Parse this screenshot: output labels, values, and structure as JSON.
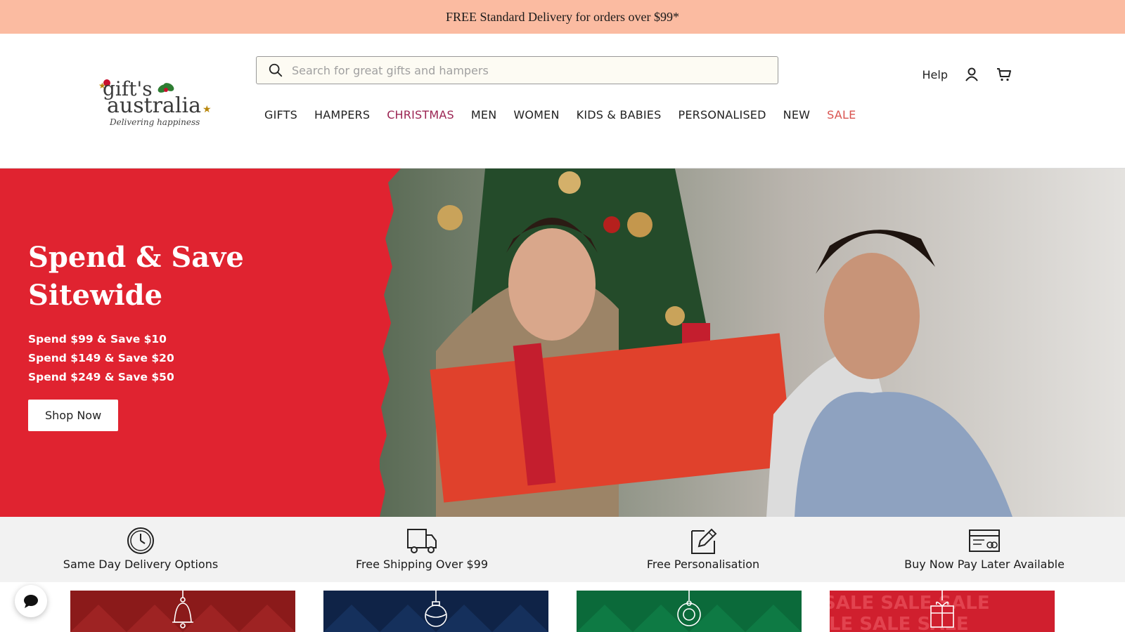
{
  "announcement": "FREE Standard Delivery for orders over $99*",
  "logo": {
    "brand_line1": "gift's",
    "brand_line2": "australia",
    "tagline": "Delivering happiness"
  },
  "search": {
    "placeholder": "Search for great gifts and hampers",
    "value": ""
  },
  "nav": [
    {
      "label": "GIFTS"
    },
    {
      "label": "HAMPERS"
    },
    {
      "label": "CHRISTMAS",
      "color": "#9b2452"
    },
    {
      "label": "MEN"
    },
    {
      "label": "WOMEN"
    },
    {
      "label": "KIDS & BABIES"
    },
    {
      "label": "PERSONALISED"
    },
    {
      "label": "NEW"
    },
    {
      "label": "SALE",
      "color": "#d9534f"
    }
  ],
  "utility": {
    "help": "Help",
    "account_icon": "user-icon",
    "cart_icon": "cart-icon"
  },
  "hero": {
    "title": "Spend & Save Sitewide",
    "offers": [
      "Spend $99 & Save $10",
      "Spend $149 & Save $20",
      "Spend $249 & Save $50"
    ],
    "cta": "Shop Now",
    "background_color": "#e02330"
  },
  "features": [
    {
      "label": "Same Day Delivery Options",
      "icon": "clock-icon"
    },
    {
      "label": "Free Shipping Over $99",
      "icon": "truck-icon"
    },
    {
      "label": "Free Personalisation",
      "icon": "pencil-icon"
    },
    {
      "label": "Buy Now Pay Later Available",
      "icon": "card-icon"
    }
  ],
  "category_cards": [
    {
      "icon": "bell-ornament-icon",
      "color": "#8b1a1a"
    },
    {
      "icon": "bauble-ornament-icon",
      "color": "#0f2347"
    },
    {
      "icon": "wreath-ornament-icon",
      "color": "#0b6a3a"
    },
    {
      "icon": "gift-ornament-icon",
      "color": "#d01f2e",
      "pattern_text": "SALE SALE SALE"
    }
  ],
  "chat_icon": "chat-icon",
  "colors": {
    "announcement_bg": "#fbbba1",
    "hero_red": "#e02330",
    "features_bg": "#f2f2f2"
  }
}
